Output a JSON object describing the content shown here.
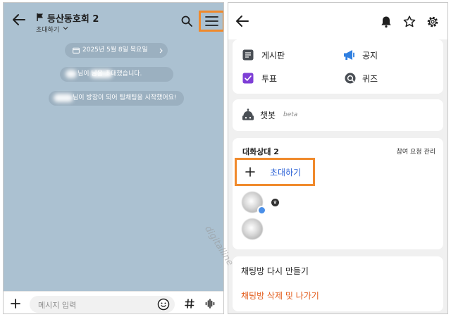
{
  "chat": {
    "room_title": "등산동호회 2",
    "invite_label": "초대하기",
    "date_pill": "2025년 5월 8일 목요일",
    "system_message_1": "님이 님을 초대했습니다.",
    "system_message_2": "님이 방장이 되어 팀채팅을 시작했어요!",
    "input_placeholder": "메시지 입력"
  },
  "drawer": {
    "menu": [
      {
        "label": "게시판",
        "icon": "board-icon"
      },
      {
        "label": "공지",
        "icon": "megaphone-icon"
      },
      {
        "label": "투표",
        "icon": "vote-icon"
      },
      {
        "label": "퀴즈",
        "icon": "quiz-icon"
      }
    ],
    "chatbot_label": "챗봇",
    "chatbot_badge": "beta",
    "participants_title": "대화상대 2",
    "manage_requests": "참여 요청 관리",
    "invite_label": "초대하기",
    "host_badge": "♛",
    "recreate_room": "채팅방 다시 만들기",
    "delete_leave": "채팅방 삭제 및 나가기"
  },
  "watermark": "digitalline",
  "colors": {
    "chat_background": "#abc1d1",
    "highlight": "#f08a2c",
    "link_blue": "#2d63d6",
    "danger": "#e35d1d",
    "vote_purple": "#7e3fd6",
    "notice_blue": "#2f7fe0"
  }
}
